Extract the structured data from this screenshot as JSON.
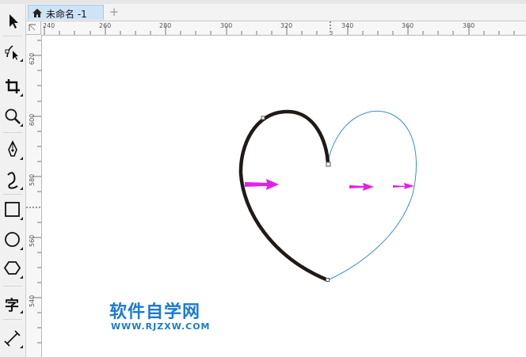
{
  "document_tab": {
    "title": "未命名 -1",
    "home_icon": "home-icon",
    "new_tab_label": "+"
  },
  "toolbox": {
    "tools": [
      {
        "name": "pick-tool",
        "icon": "arrow-pointer-icon"
      },
      {
        "name": "shape-tool",
        "icon": "node-edit-icon"
      },
      {
        "name": "crop-tool",
        "icon": "crop-icon"
      },
      {
        "name": "zoom-tool",
        "icon": "magnifier-icon"
      },
      {
        "name": "pen-tool",
        "icon": "pen-nib-icon"
      },
      {
        "name": "artistic-media-tool",
        "icon": "curve-stroke-icon"
      },
      {
        "name": "rectangle-tool",
        "icon": "rectangle-icon"
      },
      {
        "name": "ellipse-tool",
        "icon": "ellipse-icon"
      },
      {
        "name": "polygon-tool",
        "icon": "hexagon-icon"
      },
      {
        "name": "text-tool",
        "label": "字",
        "icon": "text-icon"
      },
      {
        "name": "dimension-tool",
        "icon": "dimension-line-icon"
      }
    ]
  },
  "ruler_horizontal": {
    "labels": [
      "240",
      "260",
      "280",
      "300",
      "320",
      "340",
      "360",
      "380"
    ]
  },
  "ruler_vertical": {
    "labels": [
      "620",
      "600",
      "580",
      "560",
      "540"
    ]
  },
  "ruler_corner": {
    "icon": "ruler-origin-icon"
  },
  "canvas": {
    "shapes": [
      "heart-left-half-thick-stroke",
      "heart-right-half-thin-blue-stroke"
    ],
    "arrow_color": "#e61ee6",
    "thick_stroke_color": "#1f1a17",
    "thin_stroke_color": "#3d8ecf"
  },
  "watermark": {
    "line1": "软件自学网",
    "line2": "WWW.RJZXW.COM",
    "color": "#1a7bd1"
  }
}
